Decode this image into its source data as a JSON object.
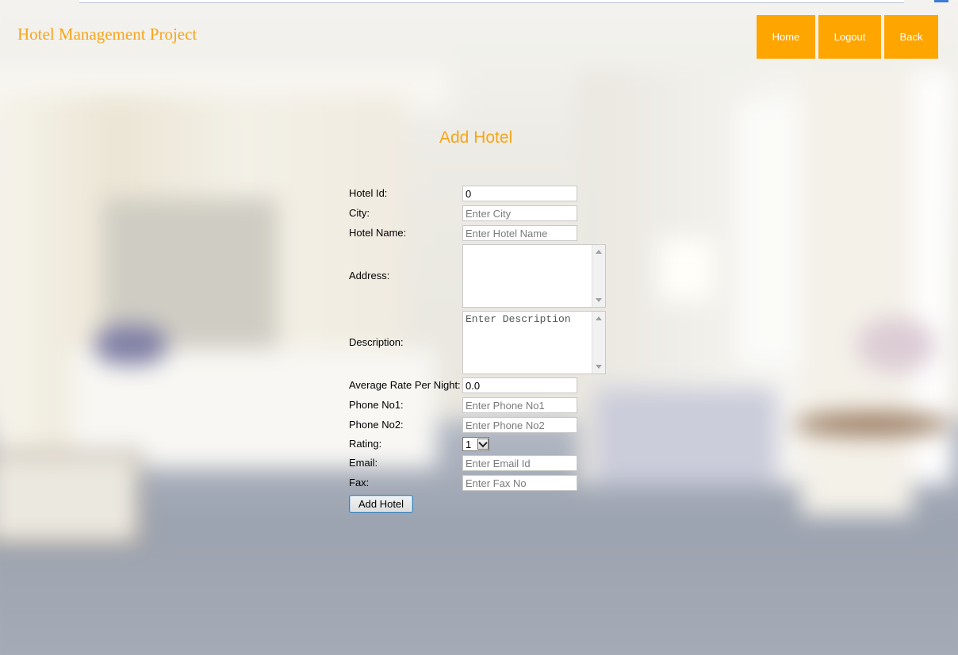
{
  "header": {
    "brand": "Hotel Management Project",
    "nav": {
      "home": "Home",
      "logout": "Logout",
      "back": "Back"
    },
    "brand_color": "#f6a51c",
    "nav_color": "#ffa500"
  },
  "form": {
    "title": "Add Hotel",
    "hotel_id": {
      "label": "Hotel Id:",
      "value": "0"
    },
    "city": {
      "label": "City:",
      "placeholder": "Enter City"
    },
    "hotel_name": {
      "label": "Hotel Name:",
      "placeholder": "Enter Hotel Name"
    },
    "address": {
      "label": "Address:",
      "placeholder": ""
    },
    "description": {
      "label": "Description:",
      "placeholder": "Enter Description"
    },
    "avg_rate": {
      "label": "Average Rate Per Night:",
      "value": "0.0"
    },
    "phone1": {
      "label": "Phone No1:",
      "placeholder": "Enter Phone No1"
    },
    "phone2": {
      "label": "Phone No2:",
      "placeholder": "Enter Phone No2"
    },
    "rating": {
      "label": "Rating:",
      "value": "1"
    },
    "email": {
      "label": "Email:",
      "placeholder": "Enter Email Id"
    },
    "fax": {
      "label": "Fax:",
      "placeholder": "Enter Fax No"
    },
    "submit_label": "Add Hotel"
  }
}
